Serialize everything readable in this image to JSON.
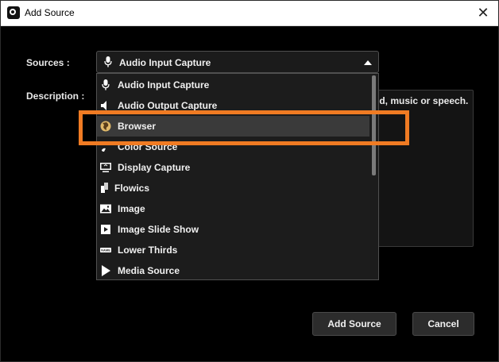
{
  "window": {
    "title": "Add Source"
  },
  "form": {
    "sources_label": "Sources :",
    "description_label": "Description :",
    "description_text": "nd, music or speech."
  },
  "combo": {
    "selected": "Audio Input Capture",
    "icon": "microphone-icon"
  },
  "dropdown": {
    "items": [
      {
        "label": "Audio Input Capture",
        "icon": "microphone-icon"
      },
      {
        "label": "Audio Output Capture",
        "icon": "speaker-icon"
      },
      {
        "label": "Browser",
        "icon": "globe-icon",
        "selected": true
      },
      {
        "label": "Color Source",
        "icon": "brush-icon"
      },
      {
        "label": "Display Capture",
        "icon": "monitor-icon"
      },
      {
        "label": "Flowics",
        "icon": "flowics-icon"
      },
      {
        "label": "Image",
        "icon": "image-icon"
      },
      {
        "label": "Image Slide Show",
        "icon": "slideshow-icon"
      },
      {
        "label": "Lower Thirds",
        "icon": "name-tag-icon"
      },
      {
        "label": "Media Source",
        "icon": "play-icon"
      }
    ]
  },
  "buttons": {
    "add": "Add Source",
    "cancel": "Cancel"
  },
  "colors": {
    "highlight": "#f07b23",
    "background": "#000000",
    "item_selected": "#3a3a3a"
  }
}
